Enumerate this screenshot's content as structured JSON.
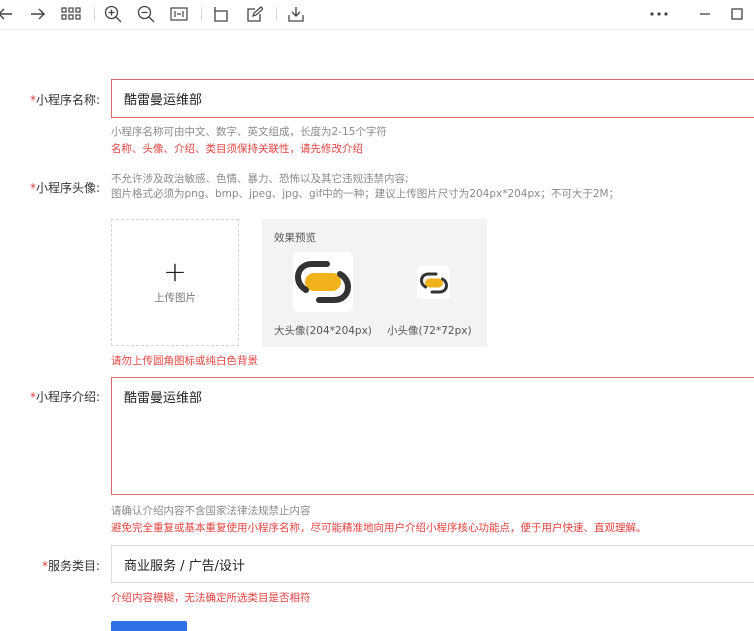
{
  "toolbar": {
    "icons": [
      "arrow-left-icon",
      "arrow-right-icon",
      "grid-icon",
      "zoom-in-icon",
      "zoom-out-icon",
      "fit-width-icon",
      "rotate-icon",
      "edit-icon",
      "download-icon",
      "more-icon",
      "minimize-icon",
      "maximize-icon"
    ]
  },
  "form": {
    "name": {
      "required_mark": "*",
      "label": "小程序名称:",
      "value": "酷雷曼运维部",
      "hint": "小程序名称可由中文、数字、英文组成，长度为2-15个字符",
      "error": "名称、头像、介绍、类目须保持关联性，请先修改介绍"
    },
    "avatar": {
      "required_mark": "*",
      "label": "小程序头像:",
      "hint_line1": "不允许涉及政治敏感、色情、暴力、恐怖以及其它违规违禁内容;",
      "hint_line2": "图片格式必须为png、bmp、jpeg、jpg、gif中的一种；建议上传图片尺寸为204px*204px；不可大于2M；",
      "upload_plus": "+",
      "upload_label": "上传图片",
      "preview_title": "效果预览",
      "big_caption": "大头像(204*204px)",
      "small_caption": "小头像(72*72px)",
      "error": "请勿上传圆角图标或纯白色背景"
    },
    "intro": {
      "required_mark": "*",
      "label": "小程序介绍:",
      "value": "酷雷曼运维部",
      "hint": "请确认介绍内容不含国家法律法规禁止内容",
      "error": "避免完全重复或基本重复使用小程序名称，尽可能精准地向用户介绍小程序核心功能点，便于用户快速、直观理解。"
    },
    "category": {
      "required_mark": "*",
      "label": "服务类目:",
      "value": "商业服务 / 广告/设计",
      "error": "介绍内容模糊，无法确定所选类目是否相符"
    }
  },
  "colors": {
    "error": "#e64340",
    "error_border": "#e0676a",
    "primary": "#2f6fe8",
    "logo_yellow": "#f2b21c",
    "logo_dark": "#333333"
  }
}
